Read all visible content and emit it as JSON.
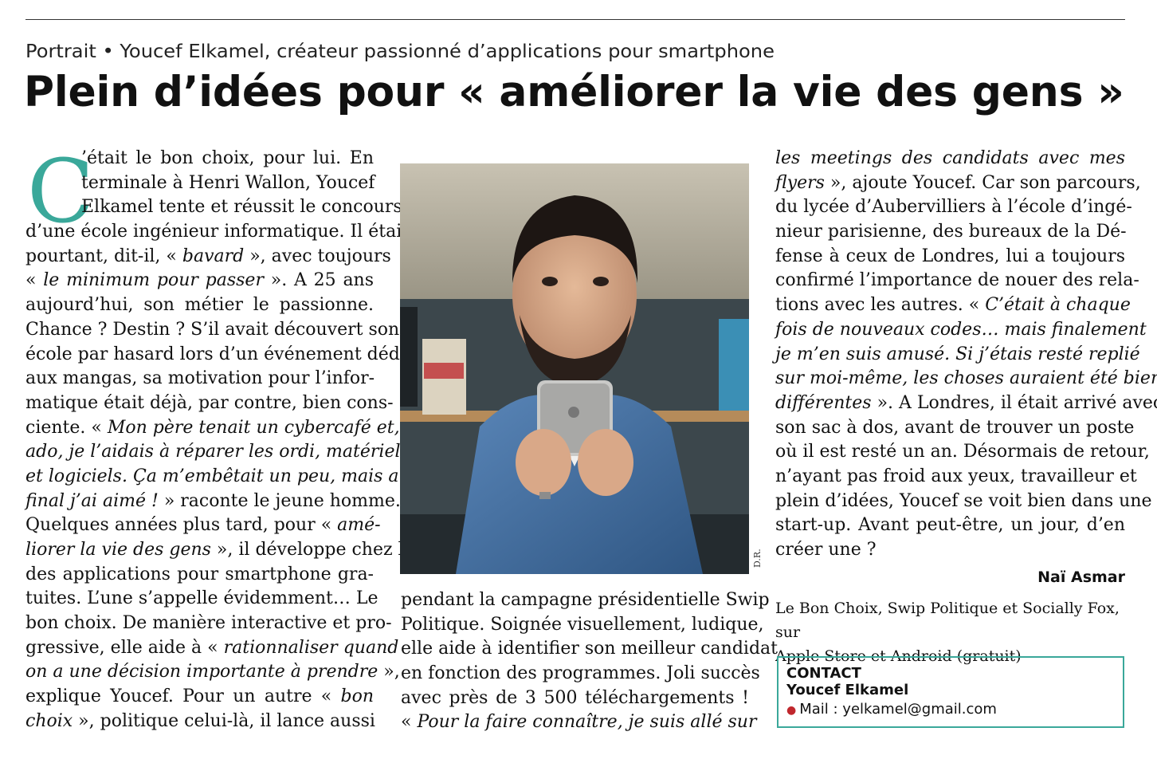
{
  "article": {
    "kicker": "Portrait • Youcef Elkamel, créateur passionné d’applications pour smartphone",
    "headline": "Plein d’idées pour « améliorer la vie des gens »",
    "dropcap": "C",
    "col1": [
      [
        "’était le bon choix, pour lui. En"
      ],
      [
        "terminale à Henri Wallon, Youcef"
      ],
      [
        "Elkamel tente et réussit le concours"
      ],
      [
        "d’une école ingénieur informatique. Il était"
      ],
      [
        "pourtant, dit-il, « ",
        "bavard",
        " », avec toujours"
      ],
      [
        "« ",
        "le minimum pour passer",
        " ». A 25 ans"
      ],
      [
        "aujourd’hui, son métier le passionne."
      ],
      [
        "Chance ? Destin ? S’il avait découvert son"
      ],
      [
        "école par hasard lors d’un événement dédié"
      ],
      [
        "aux mangas, sa motivation pour l’infor-"
      ],
      [
        "matique était déjà, par contre, bien cons-"
      ],
      [
        "ciente. « ",
        "Mon père tenait un cybercafé et,"
      ],
      [
        "",
        "ado, je l’aidais à réparer les ordi, matériel"
      ],
      [
        "",
        "et logiciels. Ça m’embêtait un peu, mais au"
      ],
      [
        "",
        "final j’ai aimé !",
        " » raconte le jeune homme."
      ],
      [
        "Quelques années plus tard, pour « ",
        "amé-"
      ],
      [
        "",
        "liorer la vie des gens",
        " », il développe chez lui"
      ],
      [
        "des applications pour smartphone gra-"
      ],
      [
        "tuites. L’une s’appelle évidemment… Le"
      ],
      [
        "bon choix. De manière interactive et pro-"
      ],
      [
        "gressive, elle aide à « ",
        "rationnaliser quand"
      ],
      [
        "",
        "on a une décision importante à prendre",
        " »,"
      ],
      [
        "explique Youcef. Pour un autre « ",
        "bon"
      ],
      [
        "",
        "choix",
        " », politique celui-là, il lance aussi"
      ]
    ],
    "col2": [
      [
        "pendant la campagne présidentielle Swip"
      ],
      [
        "Politique. Soignée visuellement, ludique,"
      ],
      [
        "elle aide à identifier son meilleur candidat"
      ],
      [
        "en fonction des programmes. Joli succès"
      ],
      [
        "avec près de 3 500 téléchargements !"
      ],
      [
        "« ",
        "Pour la faire connaître, je suis allé sur"
      ]
    ],
    "col3": [
      [
        "",
        "les meetings des candidats avec mes"
      ],
      [
        "",
        "flyers",
        " », ajoute Youcef. Car son parcours,"
      ],
      [
        "du lycée d’Aubervilliers à l’école d’ingé-"
      ],
      [
        "nieur parisienne, des bureaux de la Dé-"
      ],
      [
        "fense à ceux de Londres, lui a toujours"
      ],
      [
        "confirmé l’importance de nouer des rela-"
      ],
      [
        "tions avec les autres. « ",
        "C’était à chaque"
      ],
      [
        "",
        "fois de nouveaux codes… mais finalement"
      ],
      [
        "",
        "je m’en suis amusé. Si j’étais resté replié"
      ],
      [
        "",
        "sur moi-même, les choses auraient été bien"
      ],
      [
        "",
        "différentes",
        " ». A Londres, il était arrivé avec"
      ],
      [
        "son sac à dos, avant de trouver un poste"
      ],
      [
        "où il est resté un an. Désormais de retour,"
      ],
      [
        "n’ayant pas froid aux yeux, travailleur et"
      ],
      [
        "plein d’idées, Youcef se voit bien dans une"
      ],
      [
        "start-up. Avant peut-être, un jour, d’en"
      ],
      [
        "créer une ?"
      ]
    ],
    "photo_credit": "D.R.",
    "author": "Naï Asmar",
    "info_line1": "Le Bon Choix, Swip Politique et Socially Fox, sur",
    "info_line2": "Apple Store et Android (gratuit)",
    "contact": {
      "title": "CONTACT",
      "name": "Youcef Elkamel",
      "mail": "Mail : yelkamel@gmail.com"
    }
  },
  "colors": {
    "accent_teal": "#3aa89a",
    "bullet_red": "#c0272d",
    "text": "#111111"
  }
}
